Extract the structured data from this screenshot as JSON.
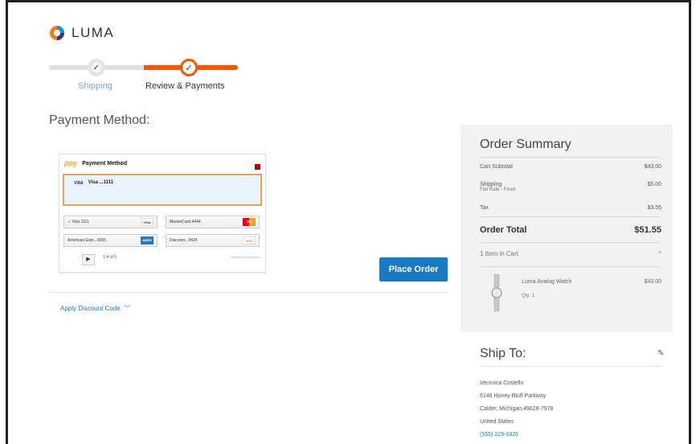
{
  "brand": {
    "name": "LUMA"
  },
  "progress": {
    "steps": [
      {
        "label": "Shipping",
        "state": "done",
        "mark": "✓"
      },
      {
        "label": "Review & Payments",
        "state": "active",
        "mark": "✓"
      }
    ]
  },
  "payment": {
    "title": "Payment Method:",
    "widget": {
      "pay_logo": "pay",
      "title": "Payment Method",
      "selected_brand": "VISA",
      "selected_card": "Visa ...1111",
      "cards": [
        {
          "label": "✓ Visa  1111",
          "badge": "VISA",
          "badge_color": "#ffffff"
        },
        {
          "label": "MasterCard  4444",
          "badge": "MC",
          "badge_color": "#eb001b"
        },
        {
          "label": "American Expr...0005",
          "badge": "AMEX",
          "badge_color": "#2e77bb"
        },
        {
          "label": "Discover...9424",
          "badge": "DISC",
          "badge_color": "#f58220"
        }
      ],
      "nav_icon": "▶",
      "page_info": "1-4 of 9",
      "powered_by": "Powered by Amazon"
    },
    "place_order_label": "Place Order",
    "discount_label": "Apply Discount Code",
    "discount_icon": "chevron-down-icon"
  },
  "summary": {
    "title": "Order Summary",
    "subtotal_label": "Cart Subtotal",
    "subtotal_value": "$43.00",
    "shipping_label": "Shipping",
    "shipping_method": "Flat Rate - Fixed",
    "shipping_value": "$5.00",
    "tax_label": "Tax",
    "tax_value": "$3.55",
    "total_label": "Order Total",
    "total_value": "$51.55",
    "items_label": "1 Item in Cart",
    "items_toggle": "^",
    "item": {
      "name": "Luma Analog Watch",
      "qty": "Qty: 1",
      "price": "$43.00"
    }
  },
  "ship_to": {
    "title": "Ship To:",
    "edit_icon": "pencil-icon",
    "name": "Veronica Costello",
    "street": "6146 Honey Bluff Parkway",
    "city_line": "Calder, Michigan 49628-7978",
    "country": "United States",
    "phone": "(555) 229-3326"
  },
  "colors": {
    "accent": "#ff5501",
    "primary_button": "#1979c3",
    "link": "#1979c3",
    "sidebar_bg": "#f2f2f2"
  }
}
